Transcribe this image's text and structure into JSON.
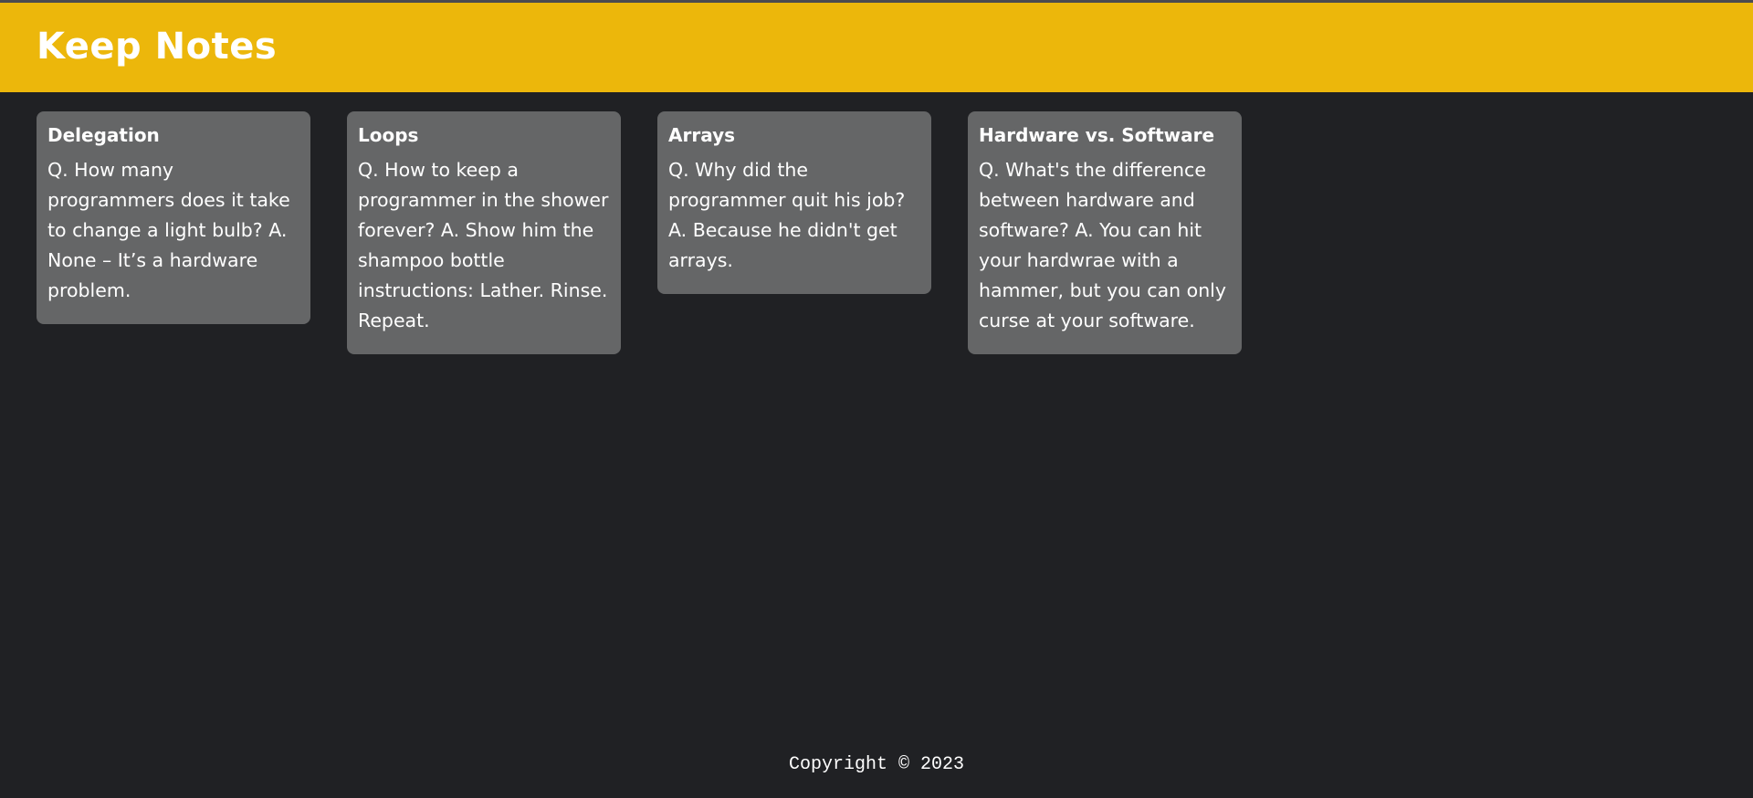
{
  "header": {
    "title": "Keep Notes",
    "background_color": "#ecb70b"
  },
  "notes": [
    {
      "title": "Delegation",
      "content": "Q. How many programmers does it take to change a light bulb? A. None – It’s a hardware problem."
    },
    {
      "title": "Loops",
      "content": "Q. How to keep a programmer in the shower forever? A. Show him the shampoo bottle instructions: Lather. Rinse. Repeat."
    },
    {
      "title": "Arrays",
      "content": "Q. Why did the programmer quit his job? A. Because he didn't get arrays."
    },
    {
      "title": "Hardware vs. Software",
      "content": "Q. What's the difference between hardware and software? A. You can hit your hardwrae with a hammer, but you can only curse at your software."
    }
  ],
  "footer": {
    "text": "Copyright © 2023"
  },
  "colors": {
    "page_background": "#202124",
    "note_background": "#656667",
    "text": "#ffffff"
  }
}
